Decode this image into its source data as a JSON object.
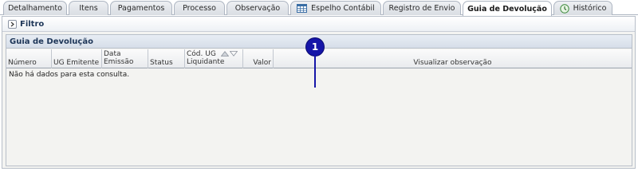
{
  "tabs": [
    {
      "label": "Detalhamento",
      "active": false
    },
    {
      "label": "Itens",
      "active": false
    },
    {
      "label": "Pagamentos",
      "active": false
    },
    {
      "label": "Processo",
      "active": false
    },
    {
      "label": "Observação",
      "active": false
    },
    {
      "label": "Espelho Contábil",
      "active": false,
      "icon": "spreadsheet-icon"
    },
    {
      "label": "Registro de Envio",
      "active": false
    },
    {
      "label": "Guia de Devolução",
      "active": true
    },
    {
      "label": "Histórico",
      "active": false,
      "icon": "history-icon"
    }
  ],
  "filter": {
    "label": "Filtro",
    "icon": "expand-arrow-icon"
  },
  "panel": {
    "title": "Guia de Devolução"
  },
  "grid": {
    "columns": [
      {
        "key": "numero",
        "label": "Número"
      },
      {
        "key": "ug_emitente",
        "label": "UG Emitente"
      },
      {
        "key": "data_emissao",
        "label": "Data Emissão"
      },
      {
        "key": "status",
        "label": "Status"
      },
      {
        "key": "cod_ug_liquidante",
        "label": "Cód. UG Liquidante",
        "sortable": true
      },
      {
        "key": "valor",
        "label": "Valor"
      },
      {
        "key": "visualizar_observacao",
        "label": "Visualizar observação"
      }
    ],
    "rows": [],
    "empty_message": "Não há dados para esta consulta."
  },
  "annotation": {
    "marker": "1"
  },
  "colors": {
    "panel_title": "#1d3557",
    "marker": "#1515a8",
    "background": "#f3f3f1"
  }
}
